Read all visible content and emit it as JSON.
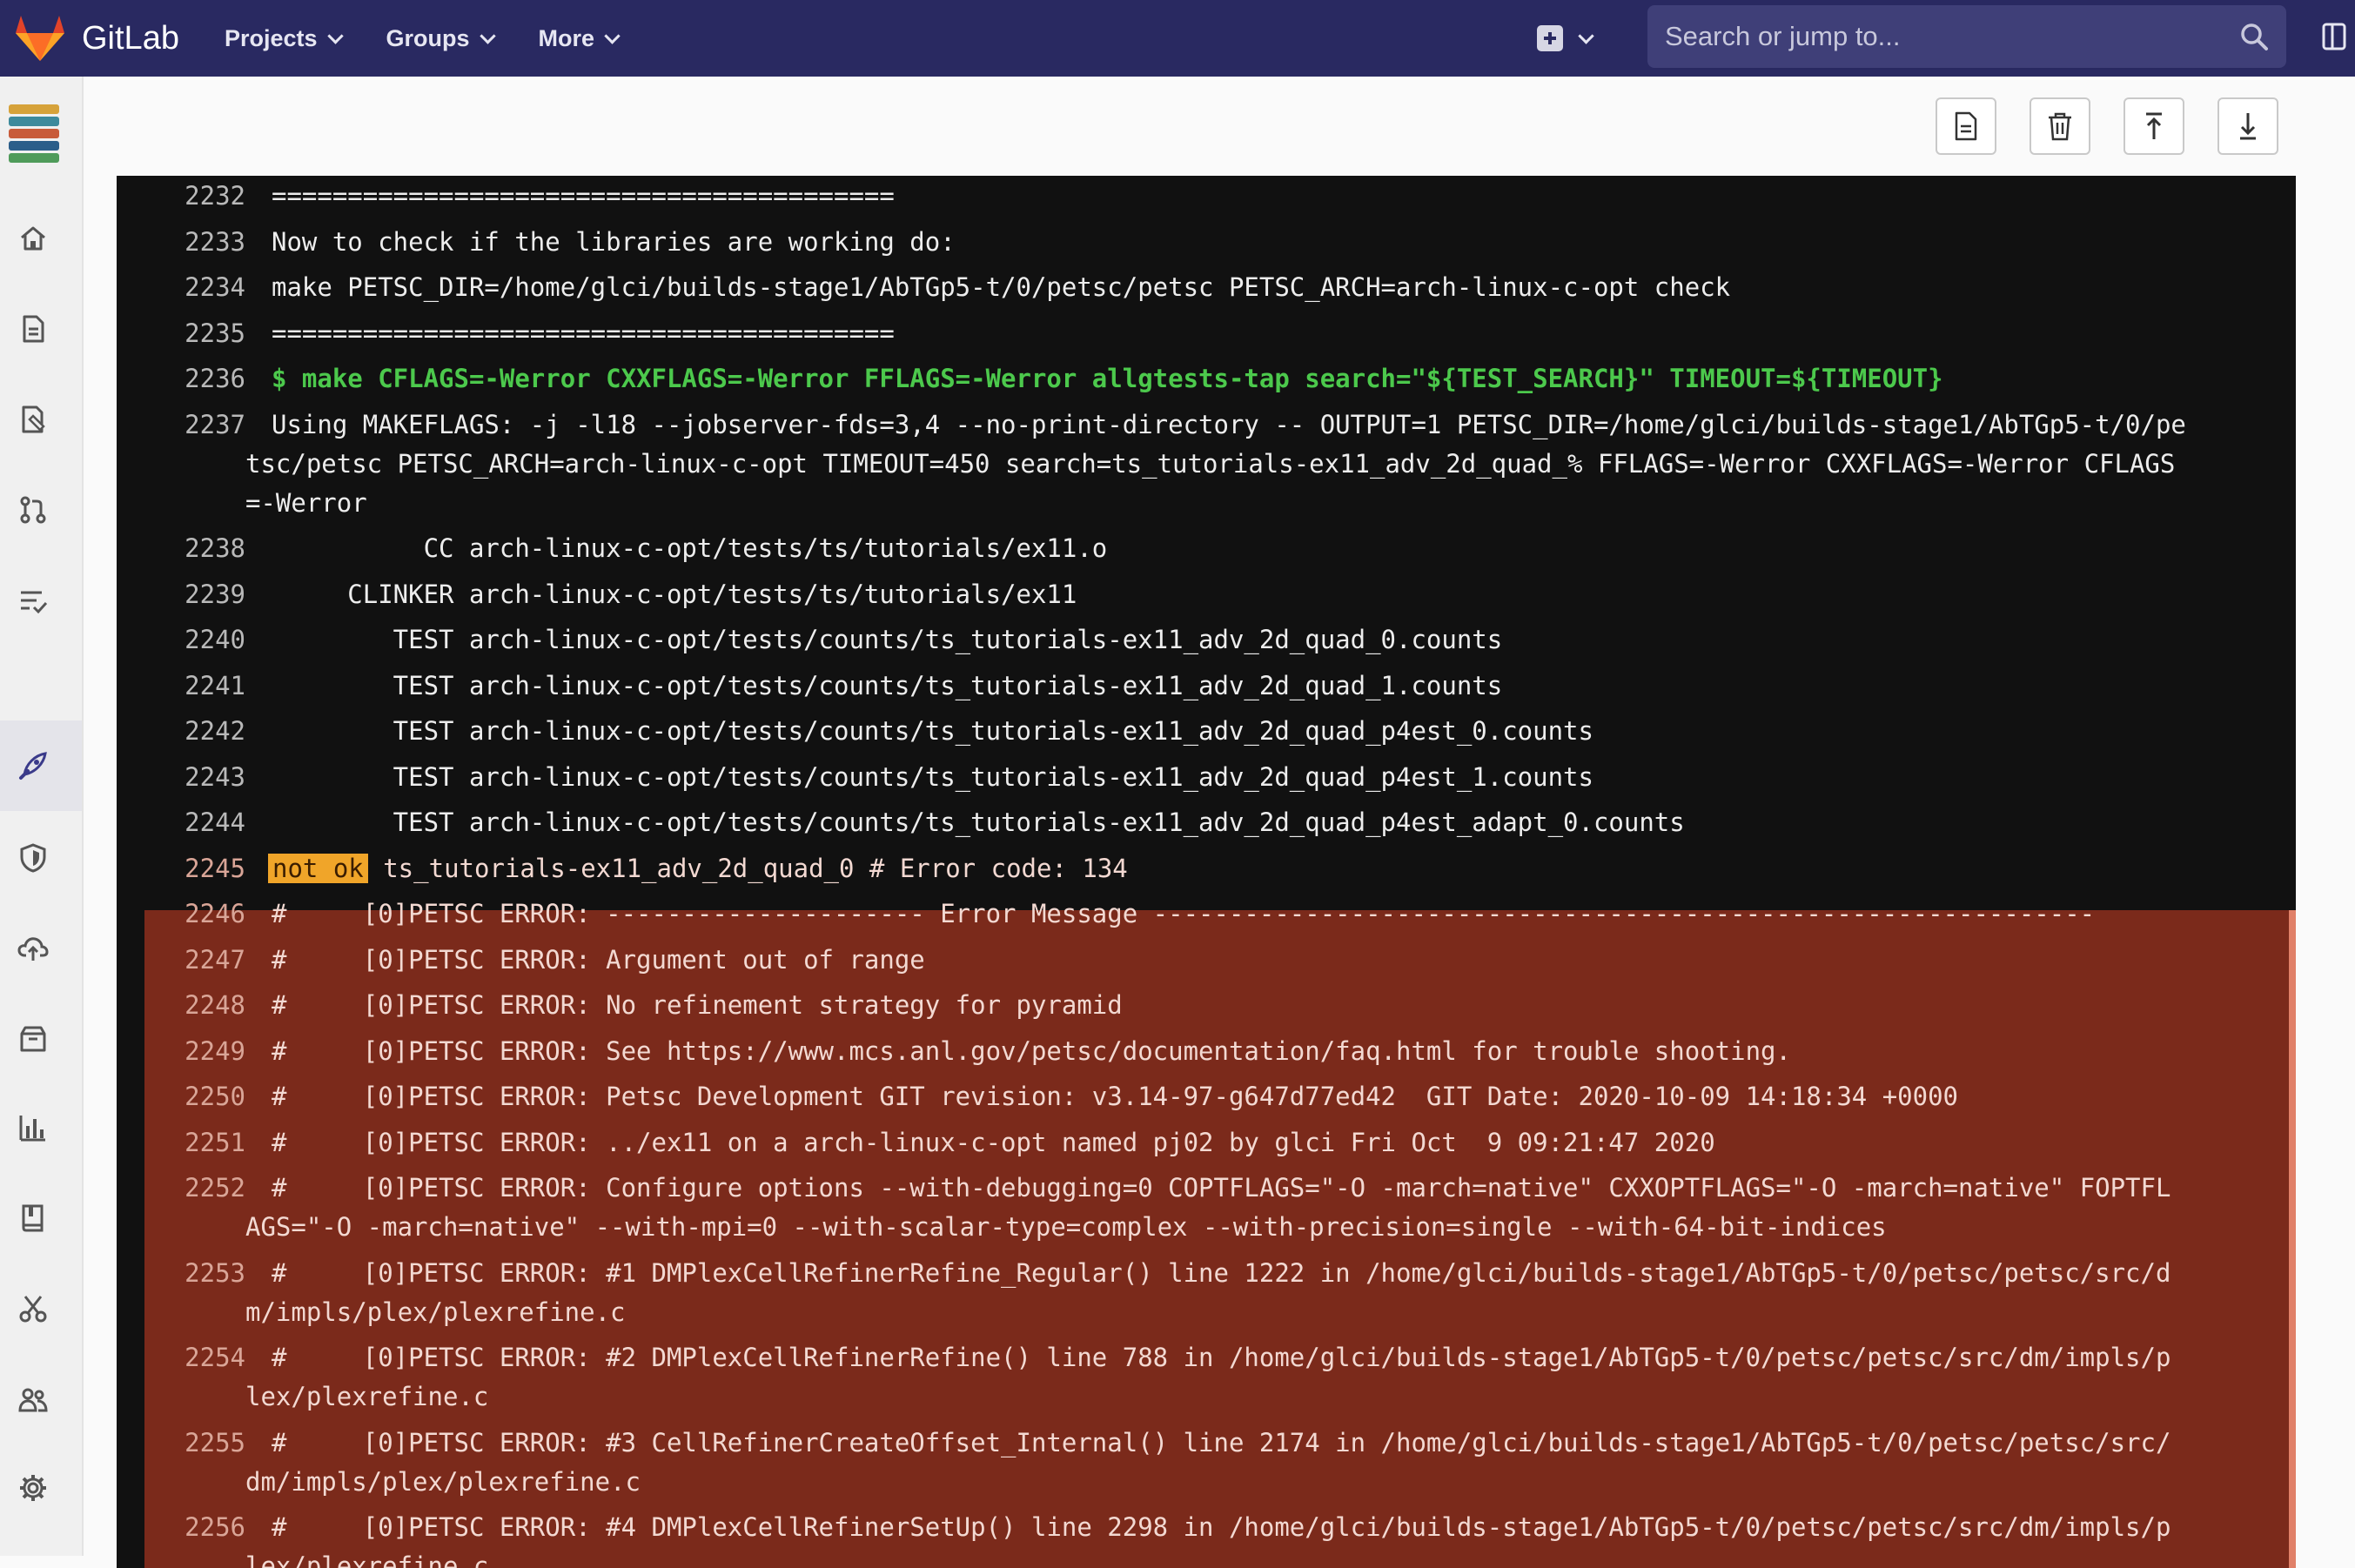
{
  "navbar": {
    "brand": "GitLab",
    "menu": [
      {
        "label": "Projects"
      },
      {
        "label": "Groups"
      },
      {
        "label": "More"
      }
    ],
    "search_placeholder": "Search or jump to..."
  },
  "sidebar": {
    "items": [
      {
        "icon": "home-icon"
      },
      {
        "icon": "document-icon"
      },
      {
        "icon": "issues-icon"
      },
      {
        "icon": "merge-request-icon"
      },
      {
        "icon": "requirements-icon"
      },
      {
        "icon": "rocket-icon",
        "active": true
      },
      {
        "icon": "shield-icon"
      },
      {
        "icon": "cloud-deploy-icon"
      },
      {
        "icon": "package-icon"
      },
      {
        "icon": "chart-icon"
      },
      {
        "icon": "wiki-book-icon"
      },
      {
        "icon": "snippets-scissors-icon"
      },
      {
        "icon": "members-icon"
      },
      {
        "icon": "settings-gear-icon"
      }
    ]
  },
  "toolbar": {
    "buttons": [
      "raw-log-icon",
      "erase-trash-icon",
      "scroll-top-icon",
      "scroll-bottom-icon"
    ]
  },
  "colors": {
    "navbar": "#292961",
    "log_bg": "#111111",
    "error_bg": "#7b2a1b",
    "command_green": "#4cc94c",
    "not_ok_badge": "#f0a529"
  },
  "log": {
    "lines": [
      {
        "n": "2232",
        "t": "========================================="
      },
      {
        "n": "2233",
        "t": "Now to check if the libraries are working do:"
      },
      {
        "n": "2234",
        "t": "make PETSC_DIR=/home/glci/builds-stage1/AbTGp5-t/0/petsc/petsc PETSC_ARCH=arch-linux-c-opt check"
      },
      {
        "n": "2235",
        "t": "========================================="
      },
      {
        "n": "2236",
        "t": "$ make CFLAGS=-Werror CXXFLAGS=-Werror FFLAGS=-Werror allgtests-tap search=\"${TEST_SEARCH}\" TIMEOUT=${TIMEOUT}"
      },
      {
        "n": "2237",
        "t": "Using MAKEFLAGS: -j -l18 --jobserver-fds=3,4 --no-print-directory -- OUTPUT=1 PETSC_DIR=/home/glci/builds-stage1/AbTGp5-t/0/pe",
        "w": [
          "tsc/petsc PETSC_ARCH=arch-linux-c-opt TIMEOUT=450 search=ts_tutorials-ex11_adv_2d_quad_% FFLAGS=-Werror CXXFLAGS=-Werror CFLAGS",
          "=-Werror"
        ]
      },
      {
        "n": "2238",
        "t": "          CC arch-linux-c-opt/tests/ts/tutorials/ex11.o"
      },
      {
        "n": "2239",
        "t": "     CLINKER arch-linux-c-opt/tests/ts/tutorials/ex11"
      },
      {
        "n": "2240",
        "t": "        TEST arch-linux-c-opt/tests/counts/ts_tutorials-ex11_adv_2d_quad_0.counts"
      },
      {
        "n": "2241",
        "t": "        TEST arch-linux-c-opt/tests/counts/ts_tutorials-ex11_adv_2d_quad_1.counts"
      },
      {
        "n": "2242",
        "t": "        TEST arch-linux-c-opt/tests/counts/ts_tutorials-ex11_adv_2d_quad_p4est_0.counts"
      },
      {
        "n": "2243",
        "t": "        TEST arch-linux-c-opt/tests/counts/ts_tutorials-ex11_adv_2d_quad_p4est_1.counts"
      },
      {
        "n": "2244",
        "t": "        TEST arch-linux-c-opt/tests/counts/ts_tutorials-ex11_adv_2d_quad_p4est_adapt_0.counts"
      },
      {
        "n": "2245",
        "badge": "not ok",
        "t": " ts_tutorials-ex11_adv_2d_quad_0 # Error code: 134"
      },
      {
        "n": "2246",
        "t": "#     [0]PETSC ERROR: --------------------- Error Message --------------------------------------------------------------"
      },
      {
        "n": "2247",
        "t": "#     [0]PETSC ERROR: Argument out of range"
      },
      {
        "n": "2248",
        "t": "#     [0]PETSC ERROR: No refinement strategy for pyramid"
      },
      {
        "n": "2249",
        "t": "#     [0]PETSC ERROR: See https://www.mcs.anl.gov/petsc/documentation/faq.html for trouble shooting."
      },
      {
        "n": "2250",
        "t": "#     [0]PETSC ERROR: Petsc Development GIT revision: v3.14-97-g647d77ed42  GIT Date: 2020-10-09 14:18:34 +0000"
      },
      {
        "n": "2251",
        "t": "#     [0]PETSC ERROR: ../ex11 on a arch-linux-c-opt named pj02 by glci Fri Oct  9 09:21:47 2020"
      },
      {
        "n": "2252",
        "t": "#     [0]PETSC ERROR: Configure options --with-debugging=0 COPTFLAGS=\"-O -march=native\" CXXOPTFLAGS=\"-O -march=native\" FOPTFL",
        "w": [
          "AGS=\"-O -march=native\" --with-mpi=0 --with-scalar-type=complex --with-precision=single --with-64-bit-indices"
        ]
      },
      {
        "n": "2253",
        "t": "#     [0]PETSC ERROR: #1 DMPlexCellRefinerRefine_Regular() line 1222 in /home/glci/builds-stage1/AbTGp5-t/0/petsc/petsc/src/d",
        "w": [
          "m/impls/plex/plexrefine.c"
        ]
      },
      {
        "n": "2254",
        "t": "#     [0]PETSC ERROR: #2 DMPlexCellRefinerRefine() line 788 in /home/glci/builds-stage1/AbTGp5-t/0/petsc/petsc/src/dm/impls/p",
        "w": [
          "lex/plexrefine.c"
        ]
      },
      {
        "n": "2255",
        "t": "#     [0]PETSC ERROR: #3 CellRefinerCreateOffset_Internal() line 2174 in /home/glci/builds-stage1/AbTGp5-t/0/petsc/petsc/src/",
        "w": [
          "dm/impls/plex/plexrefine.c"
        ]
      },
      {
        "n": "2256",
        "t": "#     [0]PETSC ERROR: #4 DMPlexCellRefinerSetUp() line 2298 in /home/glci/builds-stage1/AbTGp5-t/0/petsc/petsc/src/dm/impls/p",
        "w": [
          "lex/plexrefine.c"
        ]
      }
    ]
  }
}
